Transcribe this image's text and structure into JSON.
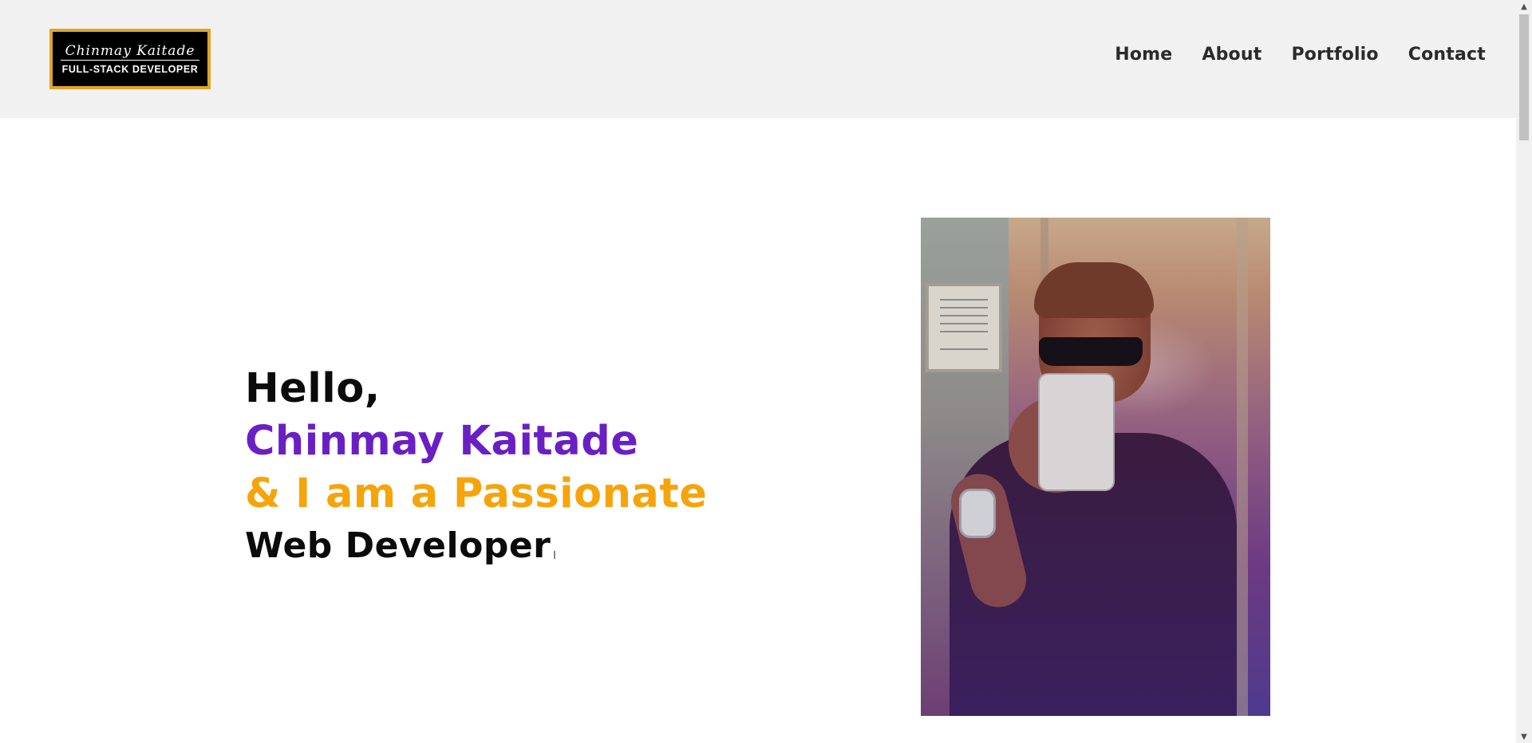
{
  "logo": {
    "script_text": "Chinmay Kaitade",
    "subtitle": "FULL-STACK DEVELOPER"
  },
  "nav": {
    "items": [
      "Home",
      "About",
      "Portfolio",
      "Contact"
    ]
  },
  "hero": {
    "greeting": "Hello,",
    "name": "Chinmay Kaitade",
    "tagline": "& I am a Passionate",
    "role": "Web Developer"
  },
  "colors": {
    "header_bg": "#f1f1f1",
    "name_purple": "#6a1fc4",
    "tagline_orange": "#f6a40b",
    "logo_border_gold": "#e0a52a"
  },
  "scrollbar": {
    "up_icon": "triangle-up-icon",
    "down_icon": "triangle-down-icon"
  }
}
